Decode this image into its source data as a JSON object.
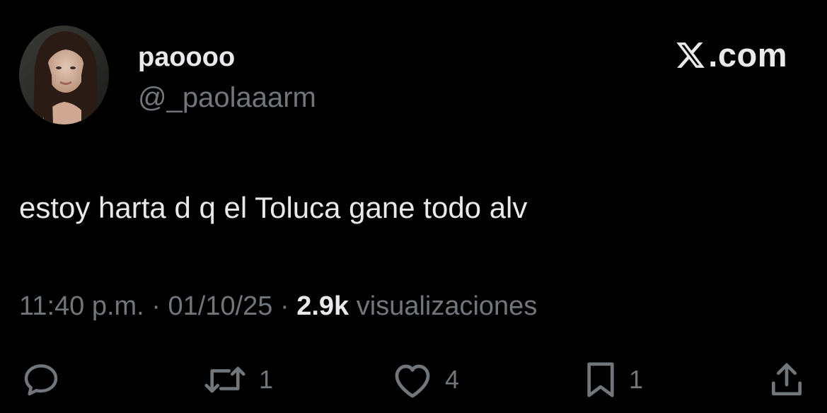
{
  "tweet": {
    "display_name": "paoooo",
    "handle": "@_paolaaarm",
    "text": "estoy harta d q el Toluca gane todo alv",
    "time": "11:40 p.m.",
    "separator": " · ",
    "date": "01/10/25",
    "views_count": "2.9k",
    "views_label": " visualizaciones"
  },
  "brand": {
    "label": ".com",
    "icon": "x-logo-icon"
  },
  "actions": {
    "reply": {
      "icon": "reply-icon"
    },
    "repost": {
      "icon": "repost-icon",
      "count": "1"
    },
    "like": {
      "icon": "heart-icon",
      "count": "4"
    },
    "bookmark": {
      "icon": "bookmark-icon",
      "count": "1"
    },
    "share": {
      "icon": "share-icon"
    }
  },
  "colors": {
    "background": "#000000",
    "primary_text": "#e7e9ea",
    "secondary_text": "#71767b"
  }
}
